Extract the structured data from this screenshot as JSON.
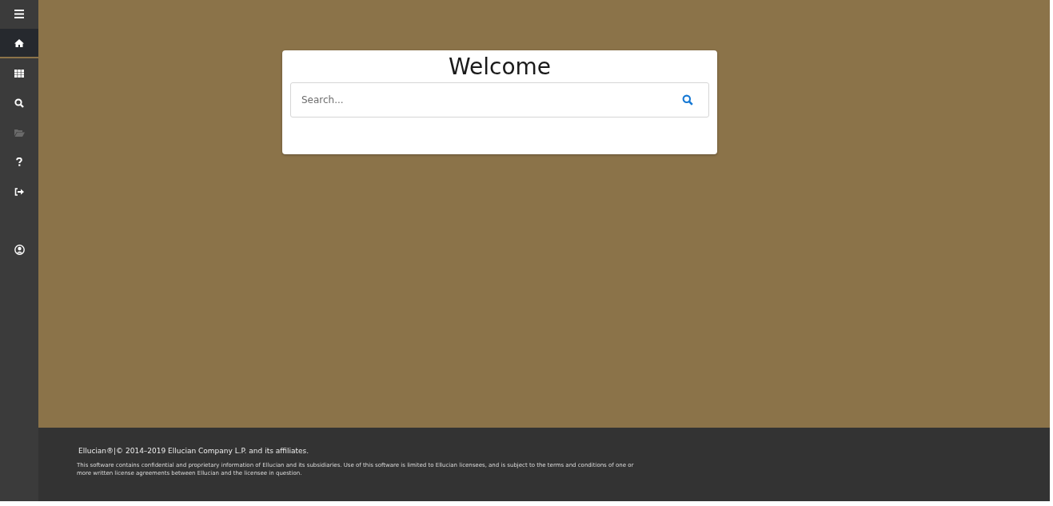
{
  "sidebar": {
    "items": [
      {
        "kind": "menu",
        "selected": false,
        "disabled": false
      },
      {
        "kind": "home",
        "selected": true,
        "disabled": false
      },
      {
        "kind": "grid",
        "selected": false,
        "disabled": false
      },
      {
        "kind": "search",
        "selected": false,
        "disabled": false
      },
      {
        "kind": "folder",
        "selected": false,
        "disabled": true
      },
      {
        "kind": "help",
        "selected": false,
        "disabled": false
      },
      {
        "kind": "signout",
        "selected": false,
        "disabled": false
      },
      {
        "kind": "user",
        "selected": false,
        "disabled": false
      }
    ]
  },
  "welcome": {
    "title": "Welcome",
    "search": {
      "placeholder": "Search..."
    }
  },
  "footer": {
    "copyright": "Ellucian®|© 2014–2019 Ellucian Company L.P. and its affiliates.",
    "notice": "This software contains confidential and proprietary information of Ellucian and its subsidiaries. Use of this software is limited to Ellucian licensees, and is subject to the terms and conditions of one or more written license agreements between Ellucian and the licensee in question."
  }
}
